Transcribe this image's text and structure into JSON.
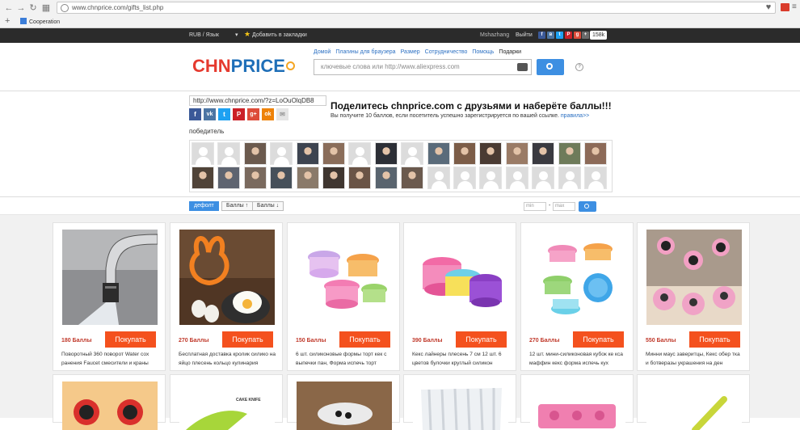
{
  "browser": {
    "url": "www.chnprice.com/gifts_list.php",
    "bookmark": "Cooperation"
  },
  "topbar": {
    "currency": "RUB / Язык",
    "bookmark": "Добавить в закладки",
    "user": "Mshazhang",
    "logout": "Выйти",
    "count": "158k"
  },
  "header": {
    "logo_a": "CHN",
    "logo_b": "PRICE",
    "nav": [
      "Домой",
      "Плагины для браузера",
      "Размер",
      "Сотрудничество",
      "Помощь",
      "Подарки"
    ],
    "search_placeholder": "ключевые слова или http://www.aliexpress.com",
    "help": "?"
  },
  "share": {
    "link": "http://www.chnprice.com/?z=LoOuOlqDB8",
    "title": "Поделитесь chnprice.com с друзьями и наберёте баллы!!!",
    "subtitle": "Вы получите 10 баллов, если посетитель успешно зарегистрируется по вашей ссылке.",
    "rules": "правила>>",
    "winner": "победитель",
    "buttons": [
      "f",
      "vk",
      "t",
      "P",
      "g+",
      "ok",
      "✉"
    ]
  },
  "sort": {
    "default": "дефолт",
    "asc": "Баллы ↑",
    "desc": "Баллы ↓",
    "min": "min",
    "sep": "-",
    "max": "max"
  },
  "products": [
    {
      "points": "180 Баллы",
      "buy": "Покупать",
      "title": "Поворотный 360 поворот Water сох ранения Faucet смесители и краны"
    },
    {
      "points": "270 Баллы",
      "buy": "Покупать",
      "title": "Бесплатная доставка кролик силико на яйцо плесень кольцо кулинария"
    },
    {
      "points": "150 Баллы",
      "buy": "Покупать",
      "title": "6 шт. силиконовые формы торт кек с выпечки пан, Форма испечь торт"
    },
    {
      "points": "390 Баллы",
      "buy": "Покупать",
      "title": "Кекс лайнеры плесень 7 см 12 шт. 6 цветов булочки круглый силикон"
    },
    {
      "points": "270 Баллы",
      "buy": "Покупать",
      "title": "12 шт. мини-силиконовая кубок ке кса маффин кекс форма испечь кух"
    },
    {
      "points": "550 Баллы",
      "buy": "Покупать",
      "title": "Минни маус заверитцы, Кекс обер тка и ботверазы украшения на ден"
    }
  ],
  "row2_caption": "CAKE KNIFE",
  "colors": {
    "accent": "#3d8fe2",
    "buy": "#f4511e",
    "points": "#c0392b",
    "topbar": "#2b2b2b"
  }
}
